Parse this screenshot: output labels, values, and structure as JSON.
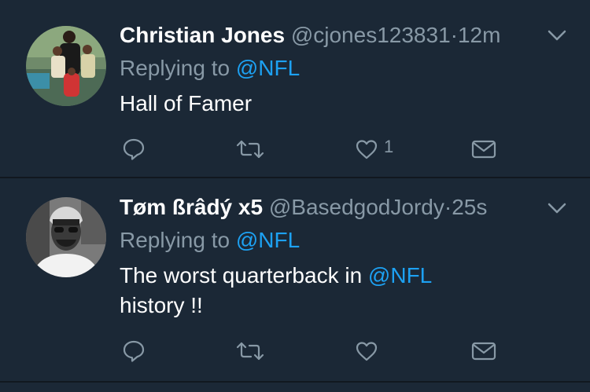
{
  "theme": {
    "background": "#1b2836",
    "divider": "#11181f",
    "text": "#ffffff",
    "muted": "#8899a6",
    "link": "#1da1f2"
  },
  "tweets": [
    {
      "display_name": "Christian Jones",
      "handle": "@cjones123831",
      "separator": "·",
      "time": "12m",
      "replying_prefix": "Replying to",
      "replying_to": "@NFL",
      "body_text": "Hall of Famer",
      "body_mention": "",
      "body_suffix": "",
      "like_count": "1",
      "icons": [
        "reply-icon",
        "retweet-icon",
        "like-icon",
        "direct-message-icon",
        "chevron-down-icon"
      ]
    },
    {
      "display_name": "Tøm ßrâdý x5",
      "handle": "@BasedgodJordy",
      "separator": "·",
      "time": "25s",
      "replying_prefix": "Replying to",
      "replying_to": "@NFL",
      "body_text": "The worst quarterback in ",
      "body_mention": "@NFL",
      "body_suffix": "history !!",
      "like_count": "",
      "icons": [
        "reply-icon",
        "retweet-icon",
        "like-icon",
        "direct-message-icon",
        "chevron-down-icon"
      ]
    }
  ]
}
